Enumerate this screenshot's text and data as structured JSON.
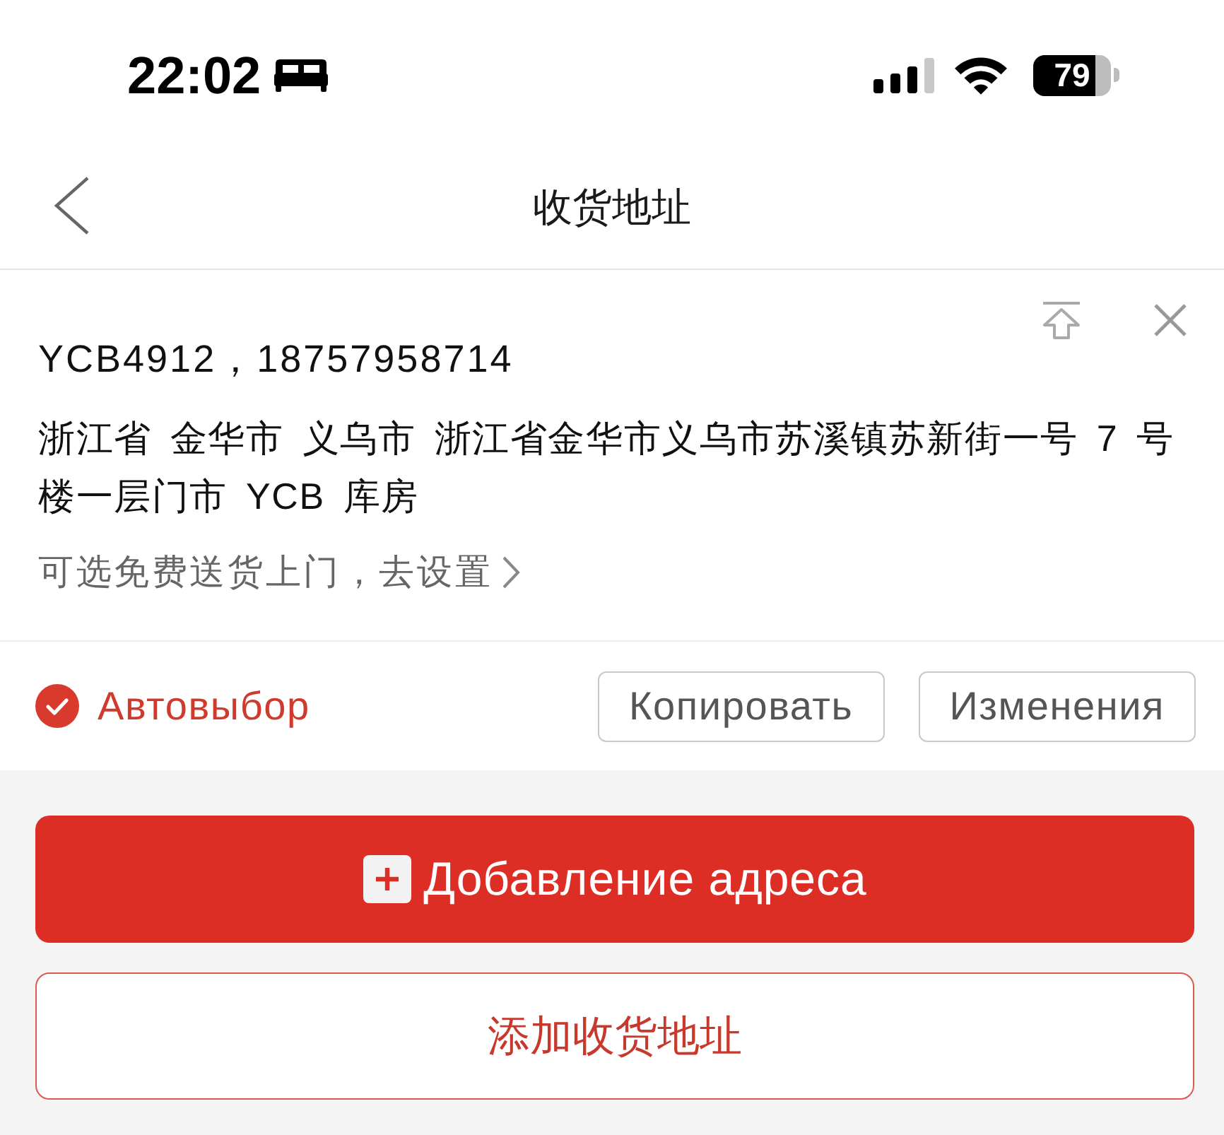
{
  "status_bar": {
    "time": "22:02",
    "battery": "79"
  },
  "header": {
    "title": "收货地址"
  },
  "address_card": {
    "contact": "YCB4912，18757958714",
    "address": "浙江省 金华市 义乌市 浙江省金华市义乌市苏溪镇苏新街一号 7 号楼一层门市 YCB 库房",
    "delivery_hint": "可选免费送货上门，去设置",
    "default_label": "Автовыбор",
    "default_checked": true,
    "buttons": [
      "Копировать",
      "Изменения"
    ]
  },
  "actions": [
    {
      "label": "Добавление адреса",
      "kind": "primary"
    },
    {
      "label": "添加收货地址",
      "kind": "outline"
    }
  ]
}
